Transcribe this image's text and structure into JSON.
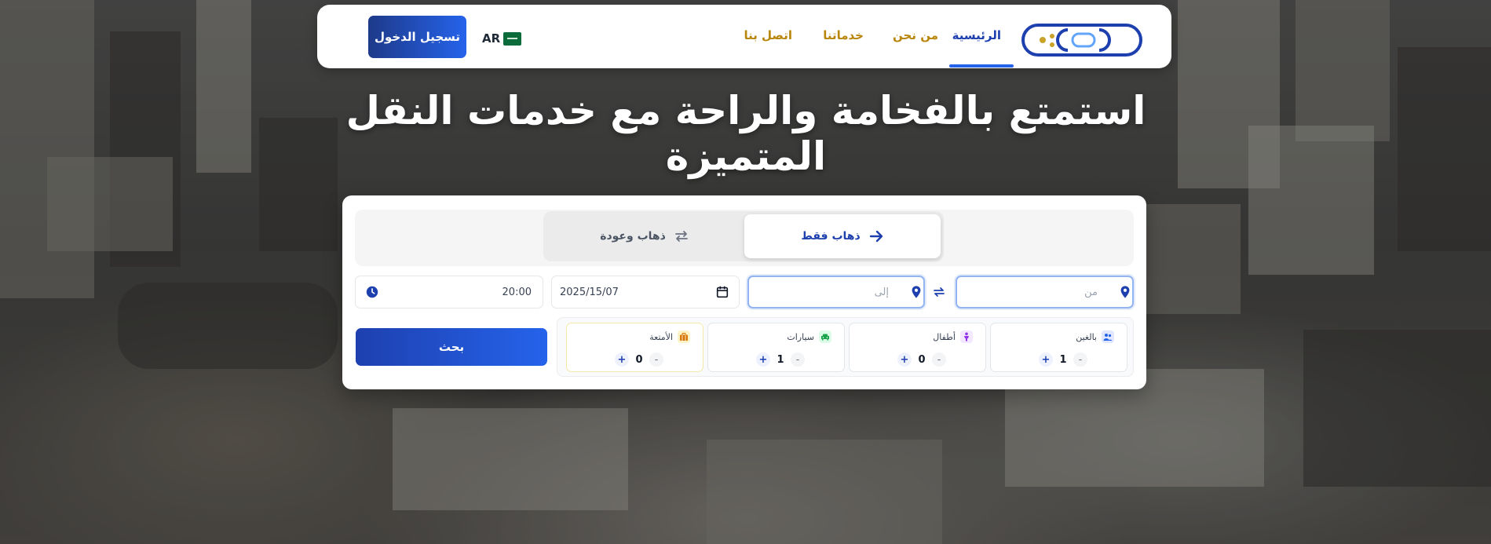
{
  "nav": {
    "links": [
      {
        "label": "الرئيسية",
        "active": true
      },
      {
        "label": "من نحن"
      },
      {
        "label": "خدماتنا"
      },
      {
        "label": "اتصل بنا"
      }
    ],
    "language": "AR",
    "login_label": "تسجيل الدخول"
  },
  "hero": {
    "title": "استمتع بالفخامة والراحة مع خدمات النقل المتميزة"
  },
  "search": {
    "tabs": {
      "one_way": "ذهاب فقط",
      "round_trip": "ذهاب وعودة"
    },
    "from_placeholder": "من",
    "to_placeholder": "إلى",
    "date_value": "2025/15/07",
    "time_value": "20:00",
    "counters": [
      {
        "label": "بالغين",
        "value": "1"
      },
      {
        "label": "أطفال",
        "value": "0"
      },
      {
        "label": "سيارات",
        "value": "1"
      },
      {
        "label": "الأمتعة",
        "value": "0"
      }
    ],
    "search_label": "بحث"
  },
  "colors": {
    "primary": "#1e40af",
    "accent": "#2563eb",
    "nav_link": "#b8860b"
  }
}
